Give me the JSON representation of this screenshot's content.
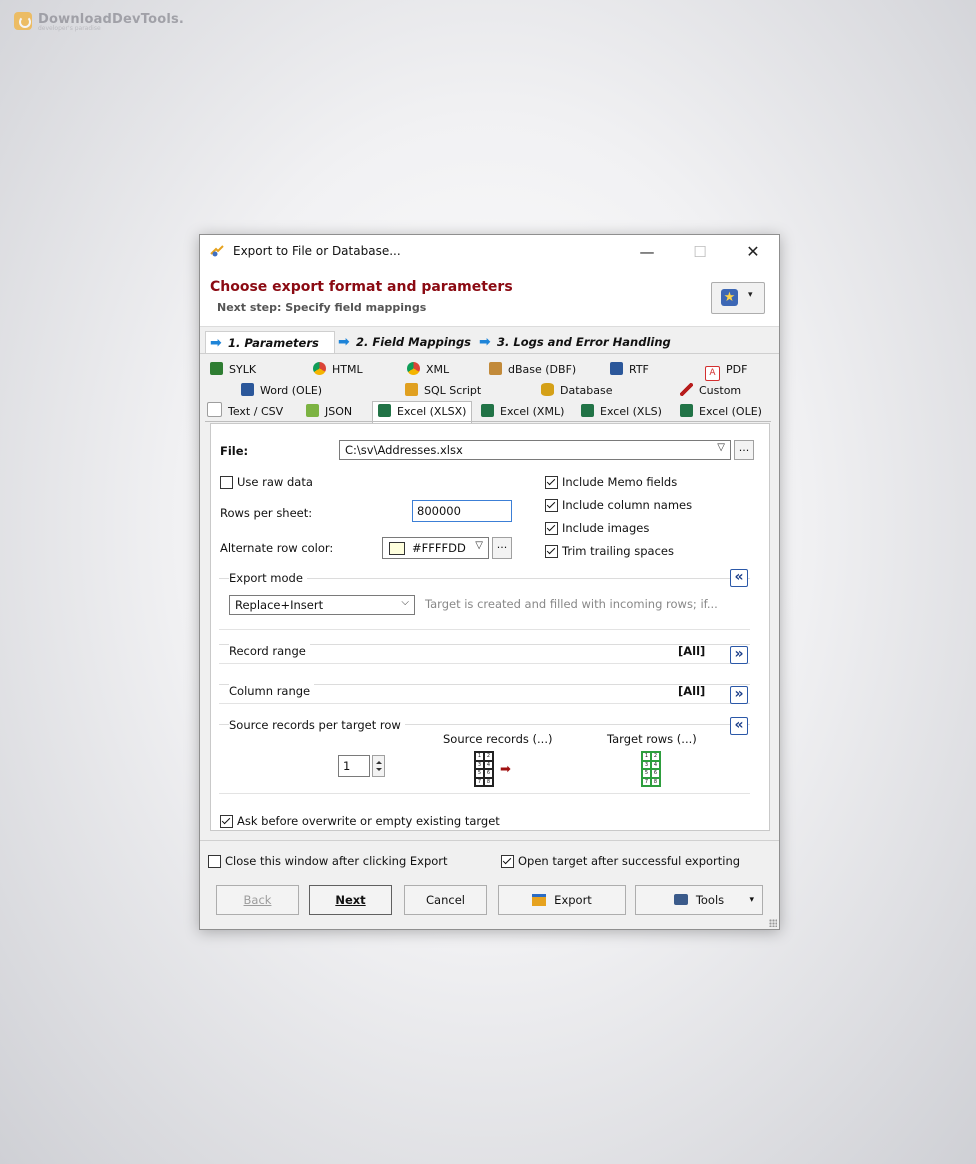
{
  "watermark": {
    "name": "DownloadDevTools.",
    "tagline": "developer's paradise"
  },
  "window": {
    "title": "Export to File or Database...",
    "minimize": "—",
    "maximize": "☐",
    "close": "✕"
  },
  "header": {
    "title": "Choose export format and parameters",
    "subtitle": "Next step: Specify field mappings",
    "fav_icon": "star-icon",
    "fav_arrow": "▾"
  },
  "steps": [
    {
      "label": "1. Parameters",
      "active": true
    },
    {
      "label": "2. Field Mappings",
      "active": false
    },
    {
      "label": "3. Logs and Error Handling",
      "active": false
    }
  ],
  "format_tabs": {
    "row1": [
      {
        "label": "SYLK",
        "icon": "sylk-icon",
        "color": "#2e7d32"
      },
      {
        "label": "HTML",
        "icon": "chrome-icon",
        "color": "#db4437"
      },
      {
        "label": "XML",
        "icon": "chrome-icon",
        "color": "#db4437"
      },
      {
        "label": "dBase (DBF)",
        "icon": "dbase-icon",
        "color": "#c28a3a"
      },
      {
        "label": "RTF",
        "icon": "word-icon",
        "color": "#2b579a"
      },
      {
        "label": "PDF",
        "icon": "pdf-icon",
        "color": "#d32f2f"
      }
    ],
    "row2": [
      {
        "label": "Word (OLE)",
        "icon": "word-icon",
        "color": "#2b579a"
      },
      {
        "label": "SQL Script",
        "icon": "sql-icon",
        "color": "#e0a020"
      },
      {
        "label": "Database",
        "icon": "database-icon",
        "color": "#d4a017"
      },
      {
        "label": "Custom",
        "icon": "pen-icon",
        "color": "#b71c1c"
      }
    ],
    "row3": [
      {
        "label": "Text / CSV",
        "icon": "text-icon",
        "color": "#9e9e9e"
      },
      {
        "label": "JSON",
        "icon": "json-icon",
        "color": "#7cb342"
      },
      {
        "label": "Excel (XLSX)",
        "icon": "excel-icon",
        "color": "#217346",
        "selected": true
      },
      {
        "label": "Excel (XML)",
        "icon": "excel-icon",
        "color": "#217346"
      },
      {
        "label": "Excel (XLS)",
        "icon": "excel-icon",
        "color": "#217346"
      },
      {
        "label": "Excel (OLE)",
        "icon": "excel-icon",
        "color": "#217346"
      }
    ]
  },
  "params": {
    "file_label": "File:",
    "file_value": "C:\\sv\\Addresses.xlsx",
    "ellipsis": "...",
    "use_raw_data": "Use raw data",
    "rows_per_sheet_label": "Rows per sheet:",
    "rows_per_sheet_value": "800000",
    "alt_row_color_label": "Alternate row color:",
    "alt_row_color_value": "#FFFFDD",
    "include_memo": "Include Memo fields",
    "include_colnames": "Include column names",
    "include_images": "Include images",
    "trim_spaces": "Trim trailing spaces"
  },
  "export_mode": {
    "title": "Export mode",
    "value": "Replace+Insert",
    "description": "Target is created and filled with incoming rows; if...",
    "toggle": "«"
  },
  "record_range": {
    "title": "Record range",
    "value": "[All]",
    "toggle": "»"
  },
  "column_range": {
    "title": "Column range",
    "value": "[All]",
    "toggle": "»"
  },
  "source_records": {
    "title": "Source records per target row",
    "value": "1",
    "source_caption": "Source records (...)",
    "target_caption": "Target rows (...)",
    "toggle": "«",
    "grid_cells": [
      "1",
      "2",
      "3",
      "4",
      "5",
      "6",
      "7",
      "8"
    ]
  },
  "ask_overwrite": "Ask before overwrite or empty existing target",
  "footer": {
    "close_after_export": "Close this window after clicking Export",
    "open_target": "Open target after successful exporting",
    "back": "Back",
    "next": "Next",
    "cancel": "Cancel",
    "export": "Export",
    "tools": "Tools",
    "tools_arrow": "▾"
  }
}
